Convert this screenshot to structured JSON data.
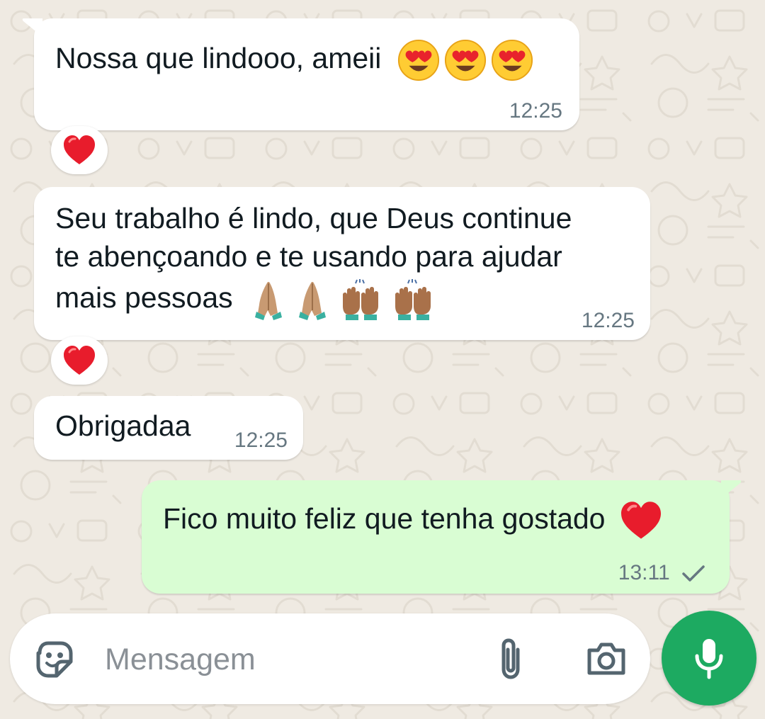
{
  "messages": [
    {
      "direction": "incoming",
      "text": "Nossa que lindooo, ameii",
      "emojis": [
        "heart-eyes",
        "heart-eyes",
        "heart-eyes"
      ],
      "time": "12:25",
      "reaction": "red-heart"
    },
    {
      "direction": "incoming",
      "lines": [
        "Seu trabalho é lindo, que Deus continue",
        "te abençoando e te usando para ajudar",
        "mais pessoas"
      ],
      "emojis": [
        "folded-hands",
        "folded-hands",
        "raising-hands",
        "raising-hands"
      ],
      "time": "12:25",
      "reaction": "red-heart"
    },
    {
      "direction": "incoming",
      "text": "Obrigadaa",
      "time": "12:25"
    },
    {
      "direction": "outgoing",
      "text": "Fico muito feliz que tenha gostado",
      "emojis": [
        "red-heart"
      ],
      "time": "13:11",
      "status": "sent-single-check"
    }
  ],
  "composer": {
    "placeholder": "Mensagem"
  },
  "colors": {
    "background": "#efeae2",
    "incoming": "#ffffff",
    "outgoing": "#d9fdd3",
    "accent": "#1daa61",
    "time": "#667781"
  }
}
